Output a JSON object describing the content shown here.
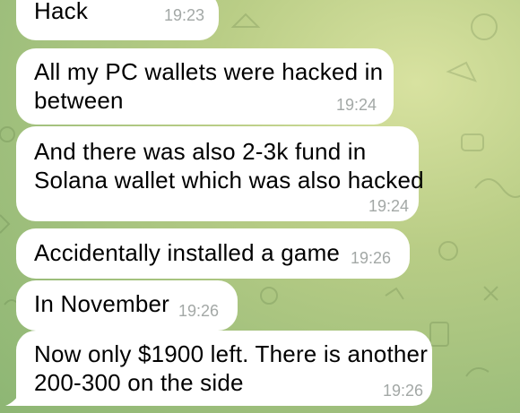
{
  "messages": [
    {
      "lines": [
        "Hack"
      ],
      "time": "19:23"
    },
    {
      "lines": [
        "All my PC wallets were hacked in",
        "between"
      ],
      "time": "19:24"
    },
    {
      "lines": [
        "And there was also 2-3k fund in",
        "Solana wallet which was also hacked"
      ],
      "time": "19:24"
    },
    {
      "lines": [
        "Accidentally installed a game"
      ],
      "time": "19:26"
    },
    {
      "lines": [
        "In November"
      ],
      "time": "19:26"
    },
    {
      "lines": [
        "Now only $1900 left. There is another",
        "200-300 on the side"
      ],
      "time": "19:26"
    }
  ],
  "colors": {
    "bubble": "#ffffff",
    "time": "#a3a8a6",
    "background": "#b9cd86"
  },
  "background_pattern": "doodle-pattern"
}
